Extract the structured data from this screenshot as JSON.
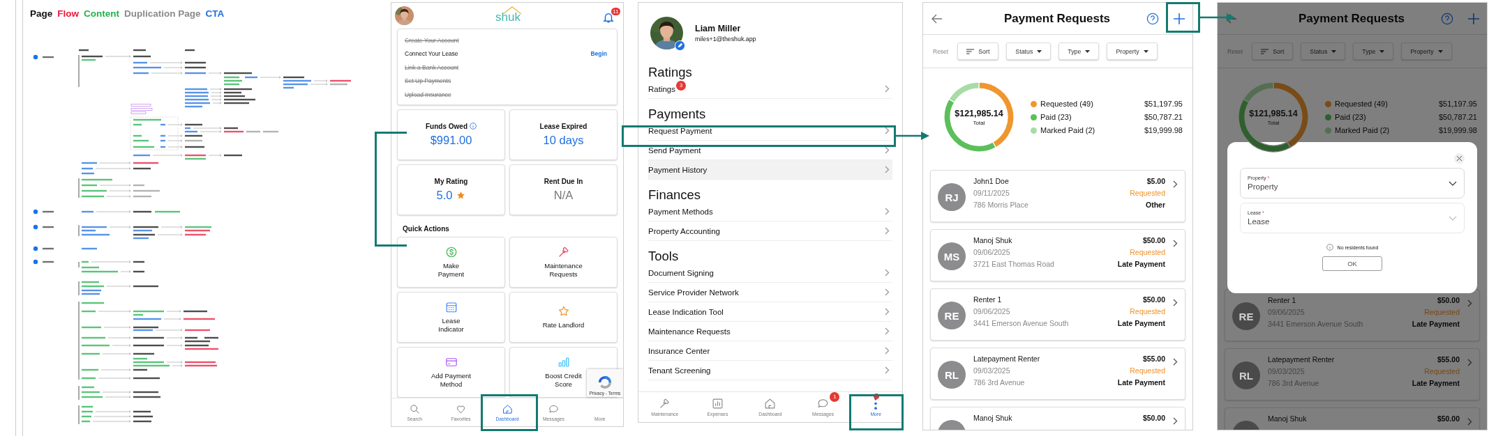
{
  "legend": [
    {
      "label": "Page",
      "color": "#111111"
    },
    {
      "label": "Flow",
      "color": "#e8173a"
    },
    {
      "label": "Content",
      "color": "#22b24c"
    },
    {
      "label": "Duplication Page",
      "color": "#8a8a8a"
    },
    {
      "label": "CTA",
      "color": "#1f6fe0"
    }
  ],
  "dashboard_screen": {
    "logo": "shuk",
    "notification_count": "11",
    "checklist": [
      {
        "label": "Create Your Account",
        "done": true
      },
      {
        "label": "Connect Your Lease",
        "done": false,
        "action": "Begin"
      },
      {
        "label": "Link a Bank Account",
        "done": true
      },
      {
        "label": "Set Up Payments",
        "done": true
      },
      {
        "label": "Upload Insurance",
        "done": true
      }
    ],
    "stats": [
      {
        "label": "Funds Owed",
        "value": "$991.00",
        "info": true,
        "star": false,
        "muted": false
      },
      {
        "label": "Lease Expired",
        "value": "10 days",
        "info": false,
        "star": false,
        "muted": false
      },
      {
        "label": "My Rating",
        "value": "5.0",
        "info": false,
        "star": true,
        "muted": false
      },
      {
        "label": "Rent Due In",
        "value": "N/A",
        "info": false,
        "star": false,
        "muted": true
      }
    ],
    "quick_actions_title": "Quick Actions",
    "quick_actions": [
      {
        "label": "Make Payment",
        "kind": "dollar"
      },
      {
        "label": "Maintenance Requests",
        "kind": "hammer"
      },
      {
        "label": "Lease Indicator",
        "kind": "calendar"
      },
      {
        "label": "Rate Landlord",
        "kind": "star"
      },
      {
        "label": "Add Payment Method",
        "kind": "card"
      },
      {
        "label": "Boost Credit Score",
        "kind": "bars"
      }
    ],
    "nav": [
      {
        "label": "Search",
        "kind": "search",
        "selected": false
      },
      {
        "label": "Favorites",
        "kind": "heart",
        "selected": false
      },
      {
        "label": "Dashboard",
        "kind": "home",
        "selected": true
      },
      {
        "label": "Messages",
        "kind": "chat",
        "selected": false
      },
      {
        "label": "More",
        "kind": "none",
        "selected": false
      }
    ],
    "recaptcha": "Privacy - Terms"
  },
  "menu_screen": {
    "name": "Liam Miller",
    "email": "miles+1@theshuk.app",
    "sections": [
      {
        "title": "Ratings",
        "items": [
          {
            "label": "Ratings",
            "badge": "3",
            "highlighted": false
          }
        ]
      },
      {
        "title": "Payments",
        "items": [
          {
            "label": "Request Payment",
            "highlighted": false
          },
          {
            "label": "Send Payment",
            "highlighted": false
          },
          {
            "label": "Payment History",
            "highlighted": true
          }
        ]
      },
      {
        "title": "Finances",
        "items": [
          {
            "label": "Payment Methods",
            "highlighted": false
          },
          {
            "label": "Property Accounting",
            "highlighted": false
          }
        ]
      },
      {
        "title": "Tools",
        "items": [
          {
            "label": "Document Signing",
            "highlighted": false
          },
          {
            "label": "Service Provider Network",
            "highlighted": false
          },
          {
            "label": "Lease Indication Tool",
            "highlighted": false
          },
          {
            "label": "Maintenance Requests",
            "highlighted": false
          },
          {
            "label": "Insurance Center",
            "highlighted": false
          },
          {
            "label": "Tenant Screening",
            "highlighted": false
          }
        ]
      }
    ],
    "nav": [
      {
        "label": "Maintenance",
        "kind": "hammer",
        "selected": false,
        "dot": false
      },
      {
        "label": "Expenses",
        "kind": "chart",
        "selected": false,
        "dot": false
      },
      {
        "label": "Dashboard",
        "kind": "home",
        "selected": false,
        "dot": false
      },
      {
        "label": "Messages",
        "kind": "chat",
        "selected": false,
        "badge": "1",
        "dot": false
      },
      {
        "label": "More",
        "kind": "dots",
        "selected": true,
        "dot": true
      }
    ]
  },
  "requests_screen": {
    "title": "Payment Requests",
    "reset": "Reset",
    "filters": [
      {
        "label": "Sort",
        "kind": "sort"
      },
      {
        "label": "Status",
        "kind": "dropdown"
      },
      {
        "label": "Type",
        "kind": "dropdown"
      },
      {
        "label": "Property",
        "kind": "dropdown"
      }
    ],
    "chart_data": {
      "type": "donut",
      "categories": [
        "Requested (49)",
        "Paid (23)",
        "Marked Paid (2)"
      ],
      "values": [
        41.97,
        41.63,
        16.4
      ]
    },
    "total": "$121,985.14",
    "total_label": "Total",
    "legend": [
      {
        "amount": "$51,197.95",
        "color": "#f0962e"
      },
      {
        "amount": "$50,787.21",
        "color": "#5cbf5a"
      },
      {
        "amount": "$19,999.98",
        "color": "#a8dca6"
      }
    ],
    "requests": [
      {
        "initials": "RJ",
        "name": "John1 Doe",
        "date": "09/11/2025",
        "address": "786 Morris Place",
        "amount": "$5.00",
        "status": "Requested",
        "type": "Other"
      },
      {
        "initials": "MS",
        "name": "Manoj Shuk",
        "date": "09/06/2025",
        "address": "3721 East Thomas Road",
        "amount": "$50.00",
        "status": "Requested",
        "type": "Late Payment"
      },
      {
        "initials": "RE",
        "name": "Renter 1",
        "date": "09/06/2025",
        "address": "3441 Emerson Avenue South",
        "amount": "$50.00",
        "status": "Requested",
        "type": "Late Payment"
      },
      {
        "initials": "RL",
        "name": "Latepayment Renter",
        "date": "09/03/2025",
        "address": "786 3rd Avenue",
        "amount": "$55.00",
        "status": "Requested",
        "type": "Late Payment"
      },
      {
        "name": "Manoj Shuk",
        "amount": "$50.00"
      }
    ]
  },
  "requests_dialog_screen": {
    "title": "Payment Requests",
    "reset": "Reset",
    "filters": [
      {
        "label": "Sort",
        "kind": "sort"
      },
      {
        "label": "Status",
        "kind": "dropdown"
      },
      {
        "label": "Type",
        "kind": "dropdown"
      },
      {
        "label": "Property",
        "kind": "dropdown"
      }
    ],
    "chart_data": {
      "type": "donut",
      "categories": [
        "Requested (49)",
        "Paid (23)",
        "Marked Paid (2)"
      ],
      "values": [
        41.97,
        41.63,
        16.4
      ]
    },
    "total": "$121,985.14",
    "total_label": "Total",
    "legend": [
      {
        "amount": "$51,197.95",
        "color": "#784b17"
      },
      {
        "amount": "$50,787.21",
        "color": "#2e602d"
      },
      {
        "amount": "$19,999.98",
        "color": "#546e53"
      }
    ],
    "requests": [
      {
        "initials": "RE",
        "name": "Renter 1",
        "date": "09/06/2025",
        "address": "3441 Emerson Avenue South",
        "amount": "$50.00",
        "status": "Requested",
        "type": "Late Payment"
      },
      {
        "initials": "RL",
        "name": "Latepayment Renter",
        "date": "09/03/2025",
        "address": "786 3rd Avenue",
        "amount": "$55.00",
        "status": "Requested",
        "type": "Late Payment"
      },
      {
        "name": "Manoj Shuk",
        "amount": "$50.00"
      }
    ],
    "dialog": {
      "fields": [
        {
          "label": "Property",
          "value": "Property",
          "required_mark": "*",
          "disabled": false
        },
        {
          "label": "Lease",
          "value": "Lease",
          "required_mark": "*",
          "disabled": true
        }
      ],
      "message": "No residents found",
      "button": "OK"
    }
  }
}
